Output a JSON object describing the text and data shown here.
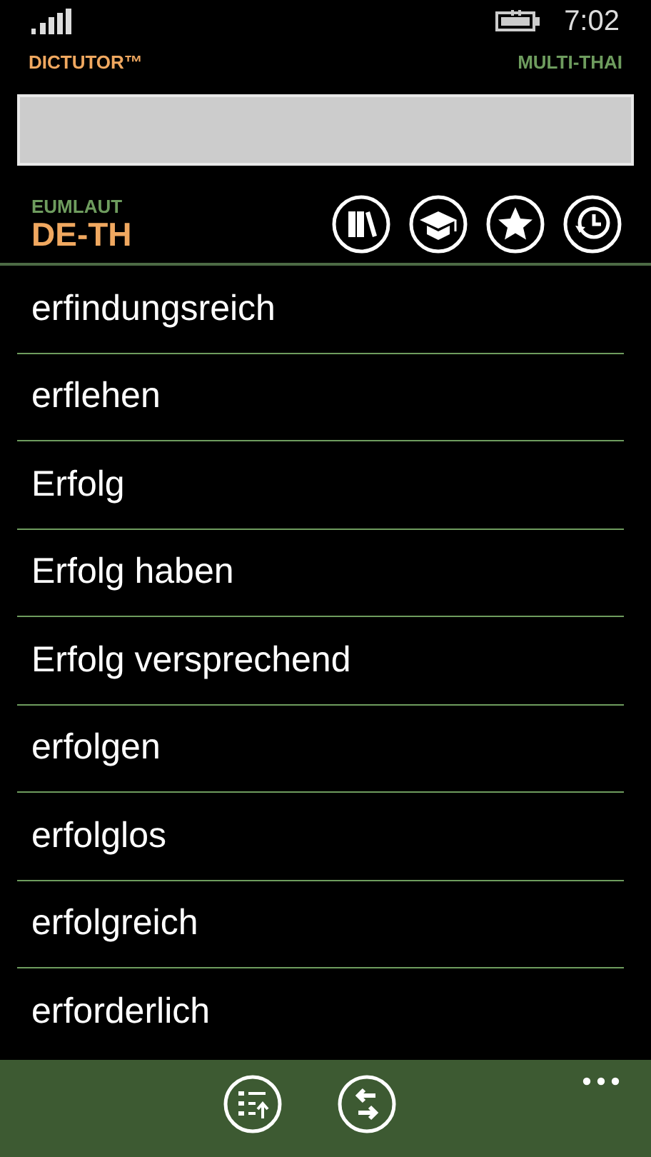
{
  "status_bar": {
    "time": "7:02"
  },
  "header": {
    "app_name": "DICTUTOR™",
    "edition": "MULTI-THAI"
  },
  "dictionary": {
    "subtitle": "EUMLAUT",
    "pair": "DE-TH"
  },
  "entries": [
    {
      "word": "erfindungsreich"
    },
    {
      "word": "erflehen"
    },
    {
      "word": "Erfolg"
    },
    {
      "word": "Erfolg haben"
    },
    {
      "word": "Erfolg versprechend"
    },
    {
      "word": "erfolgen"
    },
    {
      "word": "erfolglos"
    },
    {
      "word": "erfolgreich"
    },
    {
      "word": "erforderlich"
    }
  ]
}
